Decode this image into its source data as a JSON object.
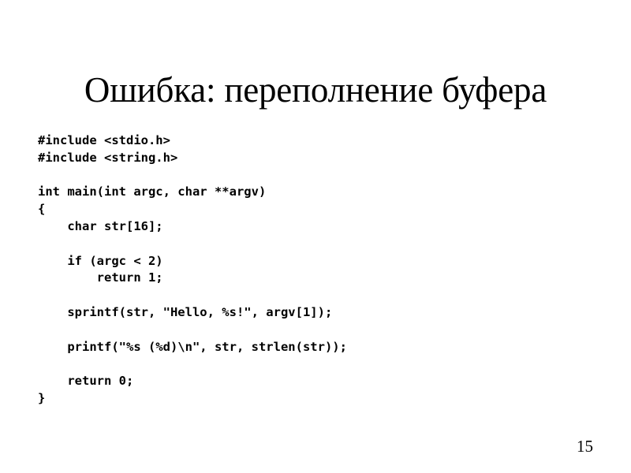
{
  "slide": {
    "title": "Ошибка: переполнение буфера",
    "page_number": "15",
    "background_color": "#ffffff",
    "text_color": "#000000"
  },
  "code": {
    "language": "c",
    "lines": [
      "#include <stdio.h>",
      "#include <string.h>",
      "",
      "int main(int argc, char **argv)",
      "{",
      "    char str[16];",
      "",
      "    if (argc < 2)",
      "        return 1;",
      "",
      "    sprintf(str, \"Hello, %s!\", argv[1]);",
      "",
      "    printf(\"%s (%d)\\n\", str, strlen(str));",
      "",
      "    return 0;",
      "}"
    ]
  }
}
